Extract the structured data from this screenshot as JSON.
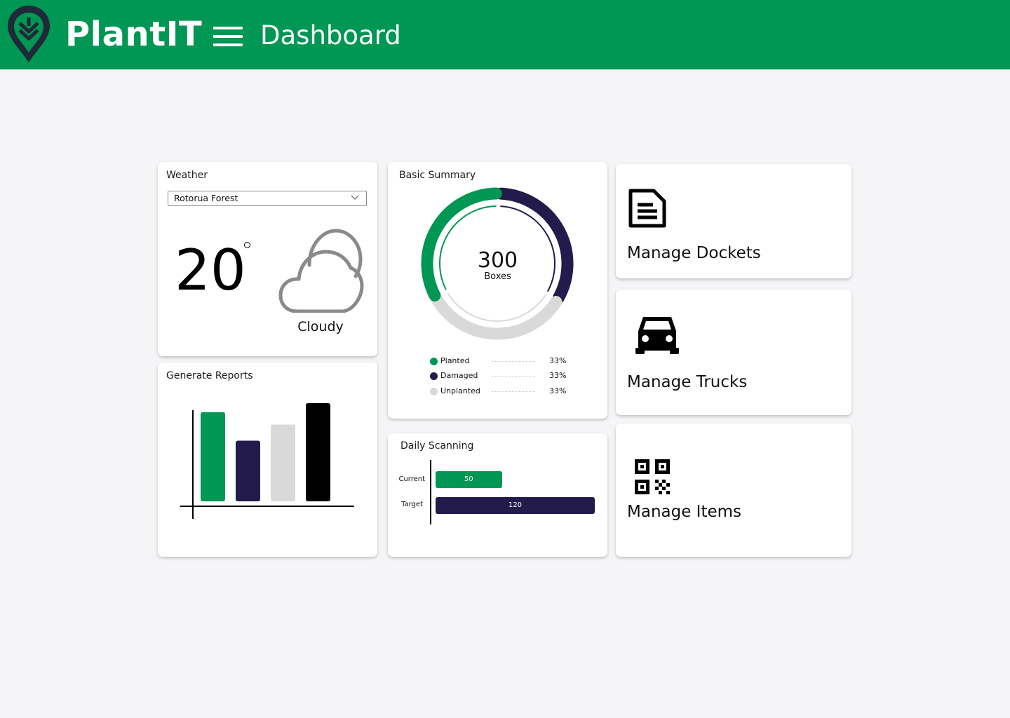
{
  "header": {
    "brand": "PlantIT",
    "title": "Dashboard",
    "color": "#009653"
  },
  "weather": {
    "title": "Weather",
    "location": "Rotorua Forest",
    "temperature": "20",
    "condition": "Cloudy",
    "icon": "cloud-icon"
  },
  "summary": {
    "title": "Basic Summary",
    "total": "300",
    "unit": "Boxes",
    "legend": [
      {
        "label": "Planted",
        "percent": "33%",
        "color": "#009653"
      },
      {
        "label": "Damaged",
        "percent": "33%",
        "color": "#221b4b"
      },
      {
        "label": "Unplanted",
        "percent": "33%",
        "color": "#d9d9d9"
      }
    ]
  },
  "reports": {
    "title": "Generate Reports"
  },
  "chart_data": [
    {
      "type": "pie",
      "title": "Basic Summary",
      "categories": [
        "Planted",
        "Damaged",
        "Unplanted"
      ],
      "values": [
        33,
        33,
        33
      ],
      "colors": [
        "#009653",
        "#221b4b",
        "#d9d9d9"
      ],
      "center_label": "300 Boxes"
    },
    {
      "type": "bar",
      "title": "Generate Reports",
      "values": [
        100,
        68,
        86,
        110
      ],
      "colors": [
        "#009653",
        "#221b4b",
        "#d9d9d9",
        "#000000"
      ],
      "grid": false
    },
    {
      "type": "bar",
      "orientation": "horizontal",
      "title": "Daily Scanning",
      "categories": [
        "Current",
        "Target"
      ],
      "values": [
        50,
        120
      ],
      "colors": [
        "#009653",
        "#221b4b"
      ],
      "xlim": [
        0,
        120
      ]
    }
  ],
  "scanning": {
    "title": "Daily Scanning"
  },
  "actions": {
    "dockets": {
      "label": "Manage Dockets",
      "icon": "document-icon"
    },
    "trucks": {
      "label": "Manage Trucks",
      "icon": "car-icon"
    },
    "items": {
      "label": "Manage Items",
      "icon": "qr-code-icon"
    }
  }
}
